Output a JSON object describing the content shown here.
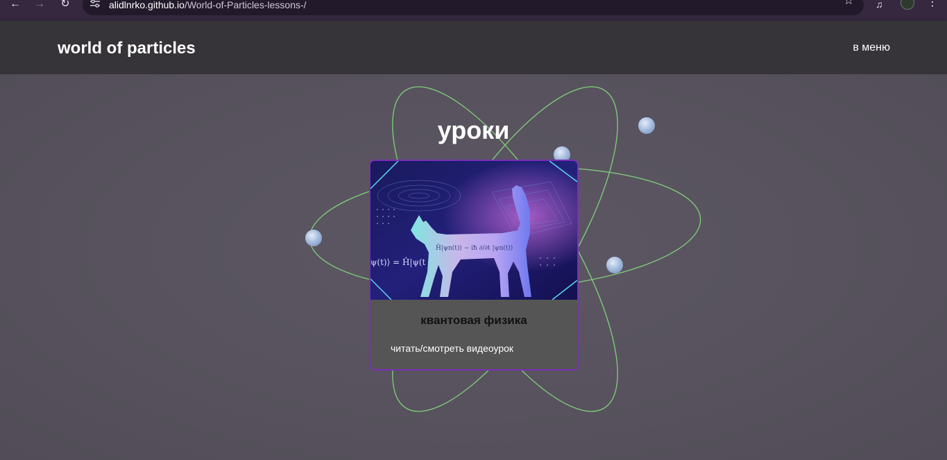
{
  "browser": {
    "url_host": "alidlnrko.github.io",
    "url_path": "/World-of-Particles-lessons-/",
    "icons": [
      "back-arrow-icon",
      "forward-arrow-icon",
      "reload-icon",
      "site-settings-icon",
      "star-icon",
      "media-control-icon",
      "profile-avatar",
      "more-menu-icon"
    ]
  },
  "header": {
    "title": "world of particles",
    "menu_link": "в меню"
  },
  "main": {
    "heading": "уроки",
    "card": {
      "title": "квантовая физика",
      "link": "читать/смотреть видеоурок",
      "image_formula_main": "Ĥ|ψn(t)⟩ − iħ ∂/∂t |ψn(t)⟩",
      "image_formula_side": "ψ(t)⟩ = Ĥ|ψ(t"
    }
  },
  "colors": {
    "header_bg": "#363438",
    "page_bg": "#58535f",
    "orbit": "#7fc97a",
    "card_border": "#7a2fb8",
    "card_bg": "#555555"
  }
}
